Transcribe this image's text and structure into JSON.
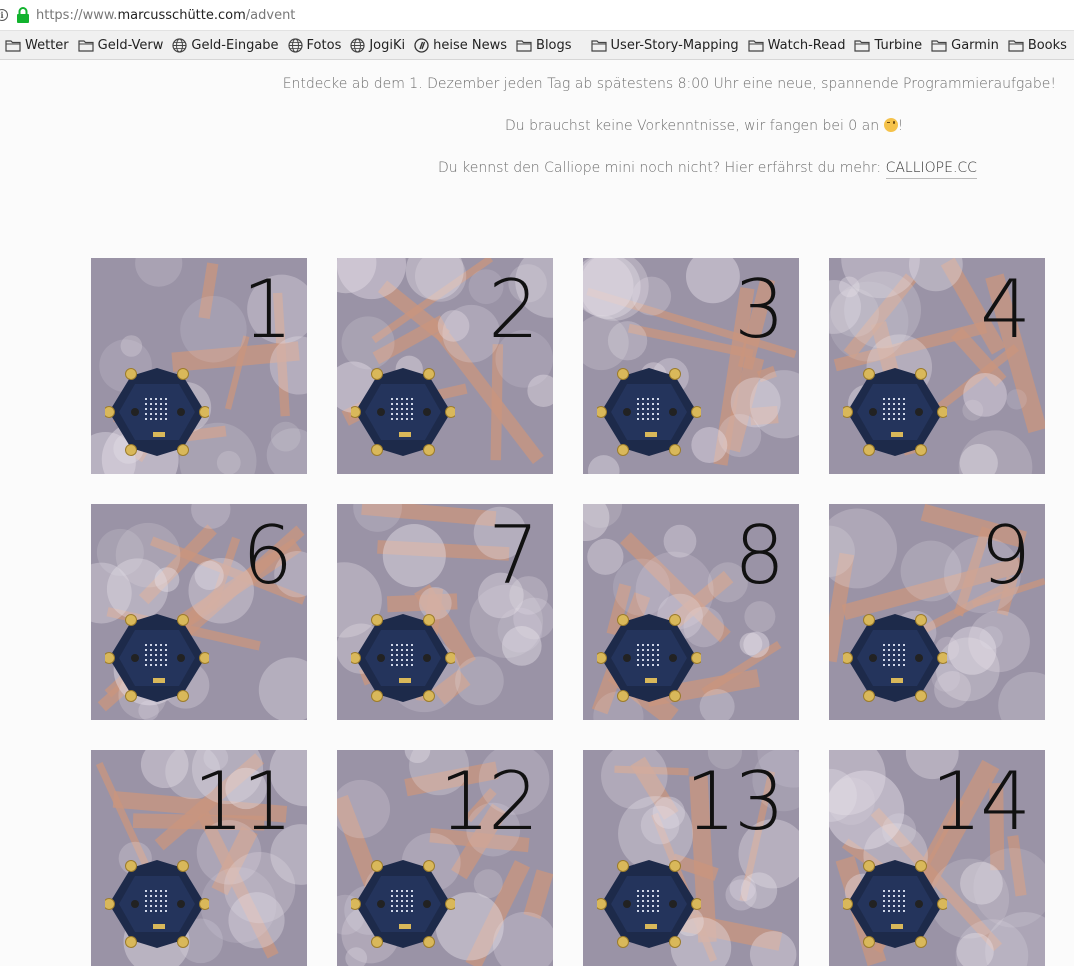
{
  "browser": {
    "url_prefix": "https://www.",
    "url_domain": "marcusschütte.com",
    "url_path": "/advent"
  },
  "bookmarks": [
    {
      "label": "Wetter",
      "icon": "folder-icon"
    },
    {
      "label": "Geld-Verw",
      "icon": "folder-icon"
    },
    {
      "label": "Geld-Eingabe",
      "icon": "globe-icon"
    },
    {
      "label": "Fotos",
      "icon": "globe-icon"
    },
    {
      "label": "JogiKi",
      "icon": "globe-icon"
    },
    {
      "label": "heise News",
      "icon": "heise-icon"
    },
    {
      "label": "Blogs",
      "icon": "folder-icon"
    },
    {
      "label": "User-Story-Mapping",
      "icon": "folder-icon"
    },
    {
      "label": "Watch-Read",
      "icon": "folder-icon"
    },
    {
      "label": "Turbine",
      "icon": "folder-icon"
    },
    {
      "label": "Garmin",
      "icon": "folder-icon"
    },
    {
      "label": "Books",
      "icon": "folder-icon"
    }
  ],
  "intro": {
    "line1": "Entdecke ab dem 1. Dezember jeden Tag ab spätestens 8:00 Uhr eine neue, spannende Programmieraufgabe!",
    "line2_before": "Du brauchst keine Vorkenntnisse, wir fangen bei 0 an ",
    "line2_after": "!",
    "line3_before": "Du kennst den Calliope mini noch nicht? Hier erfährst du mehr: ",
    "line3_link": "CALLIOPE.CC"
  },
  "tiles": [
    {
      "number": "1"
    },
    {
      "number": "2"
    },
    {
      "number": "3"
    },
    {
      "number": "4"
    },
    {
      "number": "6"
    },
    {
      "number": "7"
    },
    {
      "number": "8"
    },
    {
      "number": "9"
    },
    {
      "number": "11"
    },
    {
      "number": "12"
    },
    {
      "number": "13"
    },
    {
      "number": "14"
    }
  ],
  "colors": {
    "tile_overlay": "#9a93a6",
    "copper": "#c9957d",
    "board": "#1d2a4a",
    "pad": "#d9b85a"
  }
}
